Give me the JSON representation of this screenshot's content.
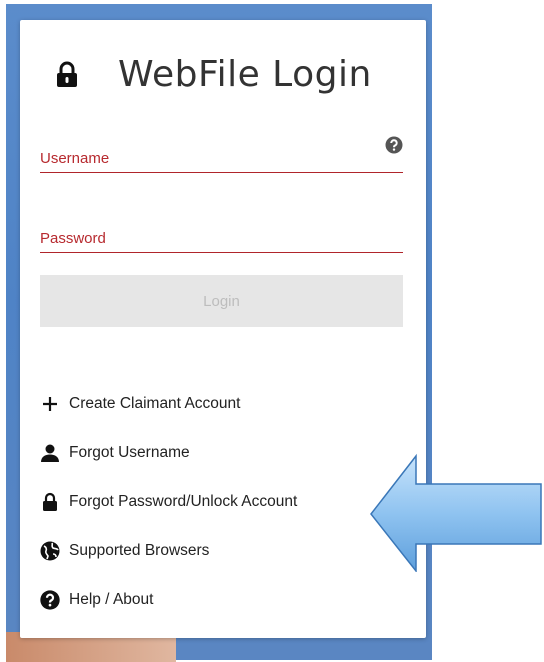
{
  "login": {
    "title": "WebFile Login",
    "username_placeholder": "Username",
    "password_placeholder": "Password",
    "login_button": "Login"
  },
  "links": [
    {
      "label": "Create Claimant Account",
      "icon": "plus-icon"
    },
    {
      "label": "Forgot Username",
      "icon": "user-icon"
    },
    {
      "label": "Forgot Password/Unlock Account",
      "icon": "lock-icon"
    },
    {
      "label": "Supported Browsers",
      "icon": "globe-icon"
    },
    {
      "label": "Help / About",
      "icon": "question-circle-icon"
    }
  ],
  "colors": {
    "accent_red": "#b72a2f",
    "frame_blue": "#4f83c6",
    "arrow_fill": "#8fc3f0"
  }
}
